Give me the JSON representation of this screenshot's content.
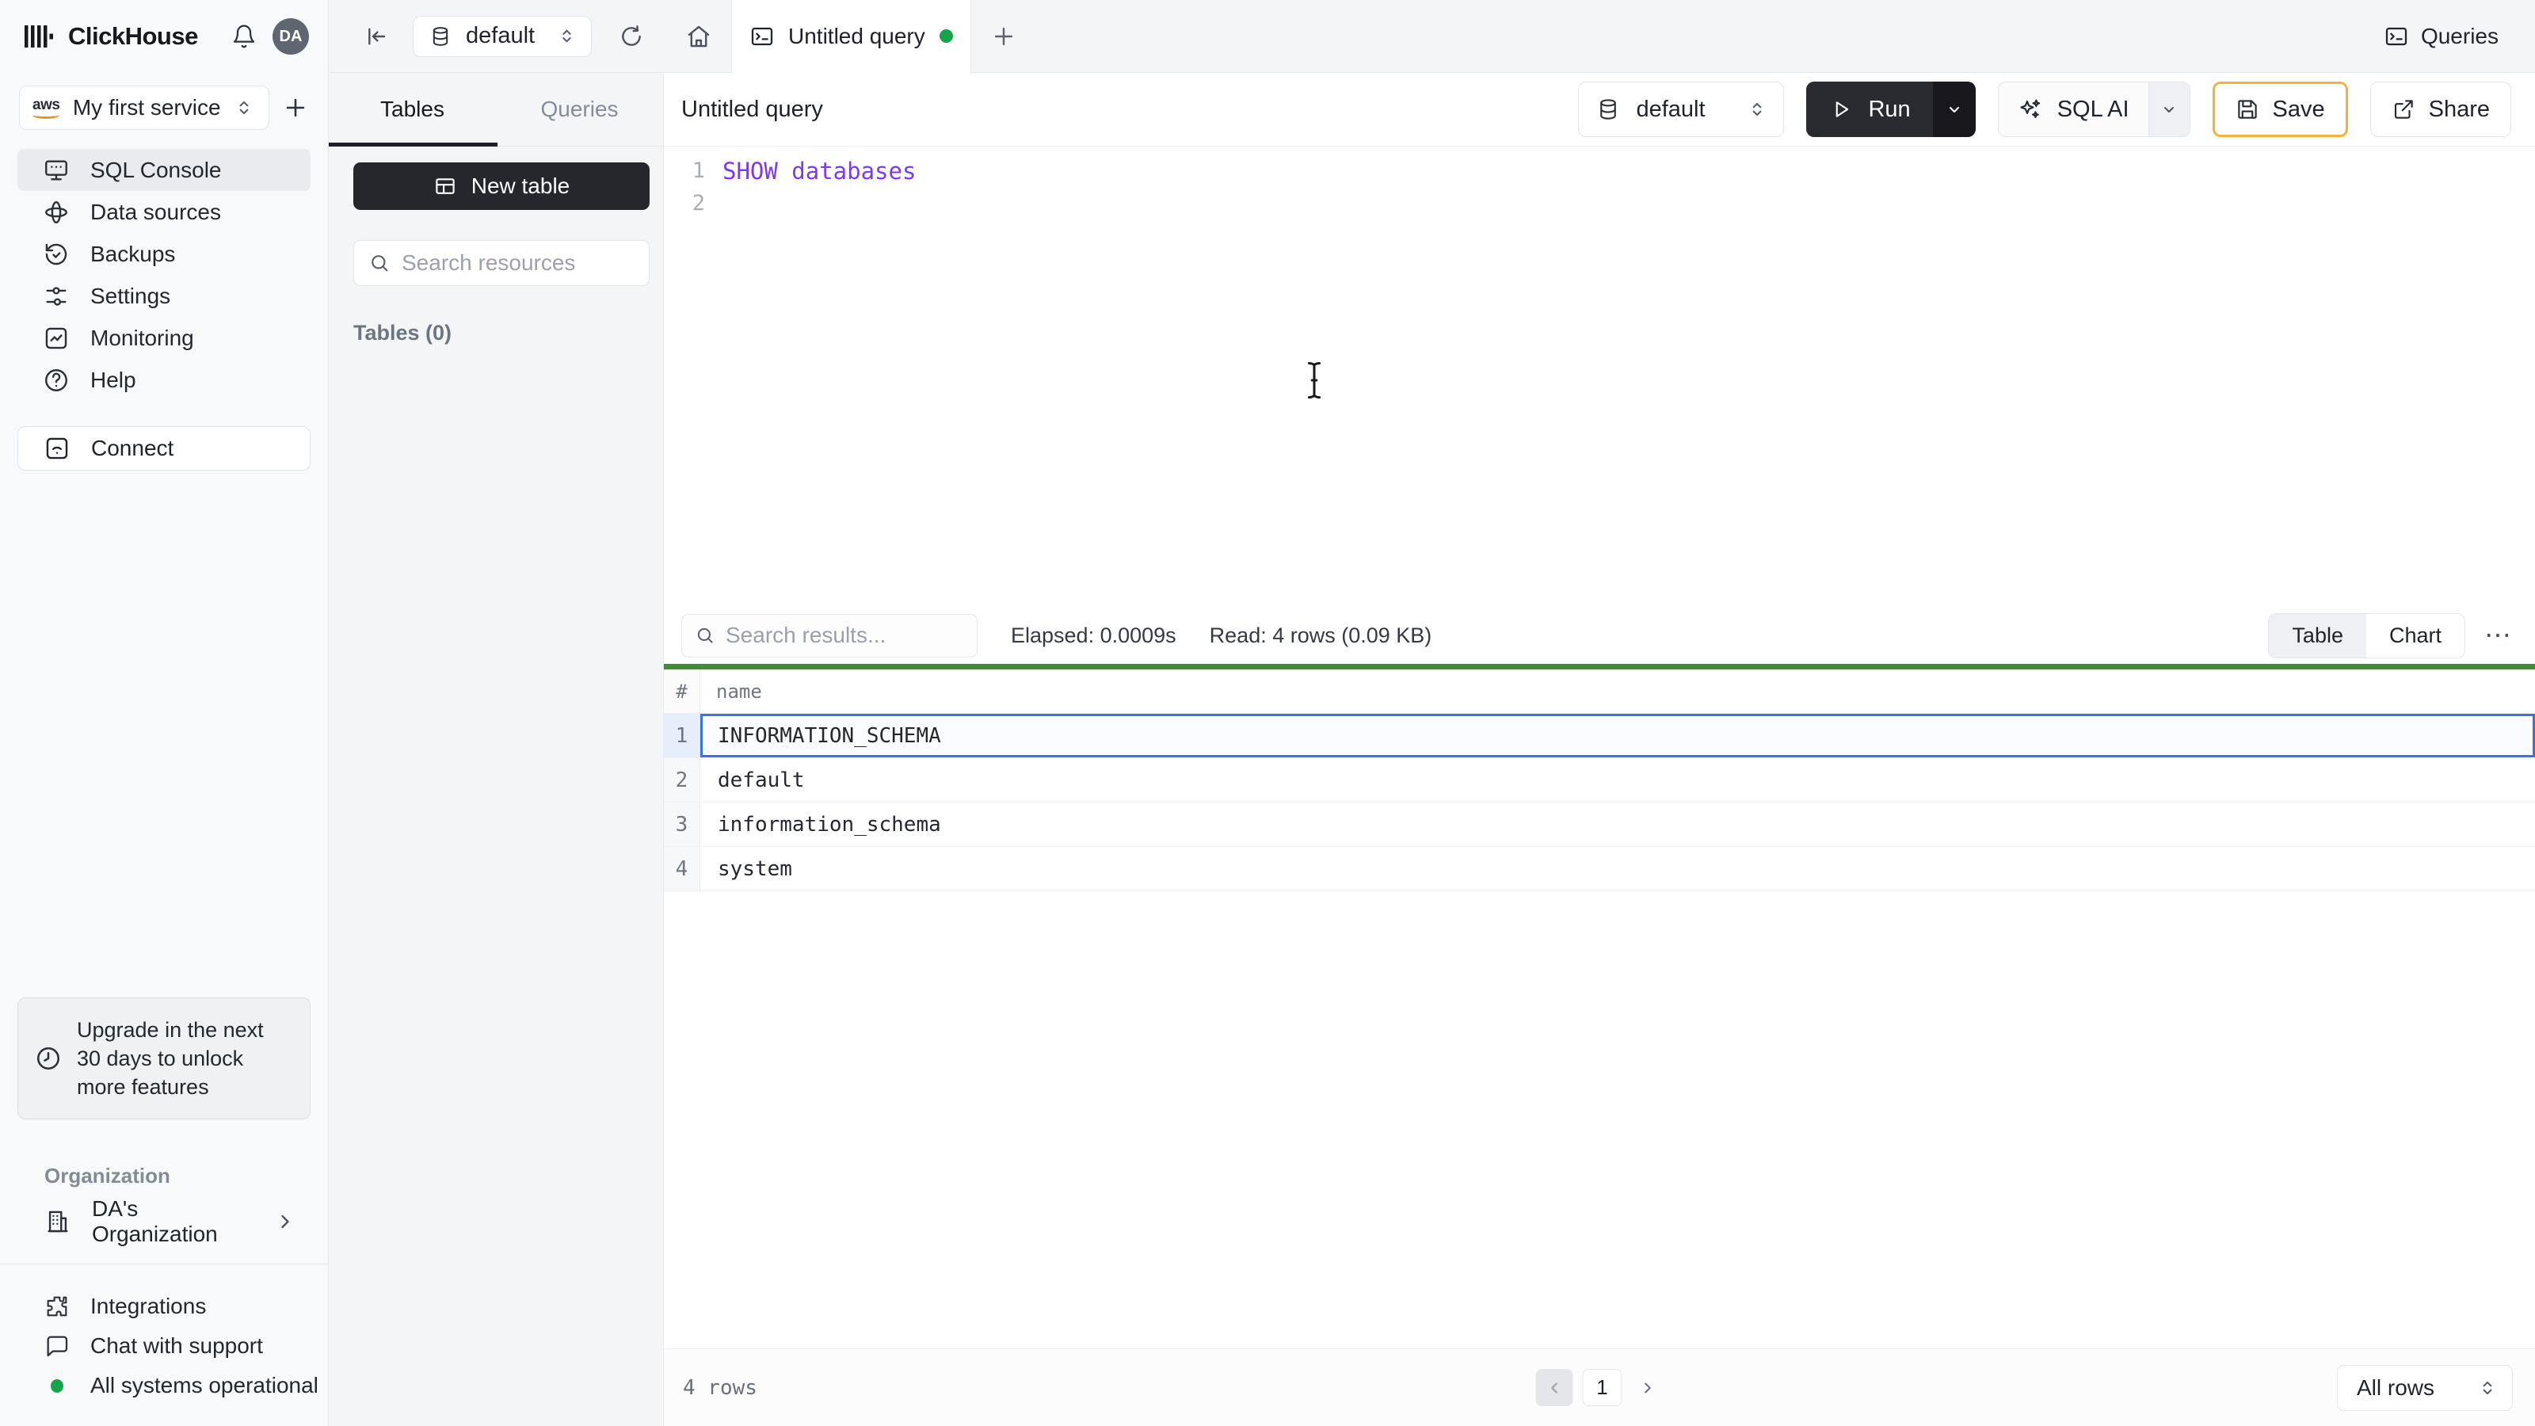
{
  "brand": {
    "name": "ClickHouse"
  },
  "topbar": {
    "avatar": "DA",
    "database": "default",
    "tab": "Untitled query",
    "queries_label": "Queries"
  },
  "sidebar": {
    "aws_label": "aws",
    "service": "My first service",
    "items": [
      {
        "label": "SQL Console"
      },
      {
        "label": "Data sources"
      },
      {
        "label": "Backups"
      },
      {
        "label": "Settings"
      },
      {
        "label": "Monitoring"
      },
      {
        "label": "Help"
      }
    ],
    "connect_label": "Connect",
    "upgrade_text": "Upgrade in the next 30 days to unlock more features",
    "organization_label": "Organization",
    "organization_name": "DA's Organization",
    "integrations_label": "Integrations",
    "chat_label": "Chat with support",
    "status_label": "All systems operational"
  },
  "resources": {
    "tab_tables": "Tables",
    "tab_queries": "Queries",
    "new_table_label": "New table",
    "search_placeholder": "Search resources",
    "tables_count": "Tables (0)"
  },
  "query": {
    "title": "Untitled query",
    "database": "default",
    "run_label": "Run",
    "sql_ai_label": "SQL AI",
    "save_label": "Save",
    "share_label": "Share",
    "lines": [
      {
        "num": "1",
        "code": "SHOW databases"
      },
      {
        "num": "2",
        "code": ""
      }
    ]
  },
  "results": {
    "search_placeholder": "Search results...",
    "elapsed": "Elapsed: 0.0009s",
    "read": "Read: 4 rows (0.09 KB)",
    "toggle": {
      "table": "Table",
      "chart": "Chart"
    },
    "ellipsis": "⋯",
    "columns": {
      "index": "#",
      "name": "name"
    },
    "rows": [
      {
        "num": "1",
        "name": "INFORMATION_SCHEMA"
      },
      {
        "num": "2",
        "name": "default"
      },
      {
        "num": "3",
        "name": "information_schema"
      },
      {
        "num": "4",
        "name": "system"
      }
    ],
    "selected_row": 1,
    "footer": {
      "total": "4 rows",
      "page": "1",
      "page_size": "All rows"
    }
  },
  "colors": {
    "success_green": "#17a34a",
    "result_bar_green": "#47873f",
    "selection_blue": "#3574e2",
    "code_keyword_purple": "#7c3aed",
    "save_border_amber": "#f2b33d"
  }
}
